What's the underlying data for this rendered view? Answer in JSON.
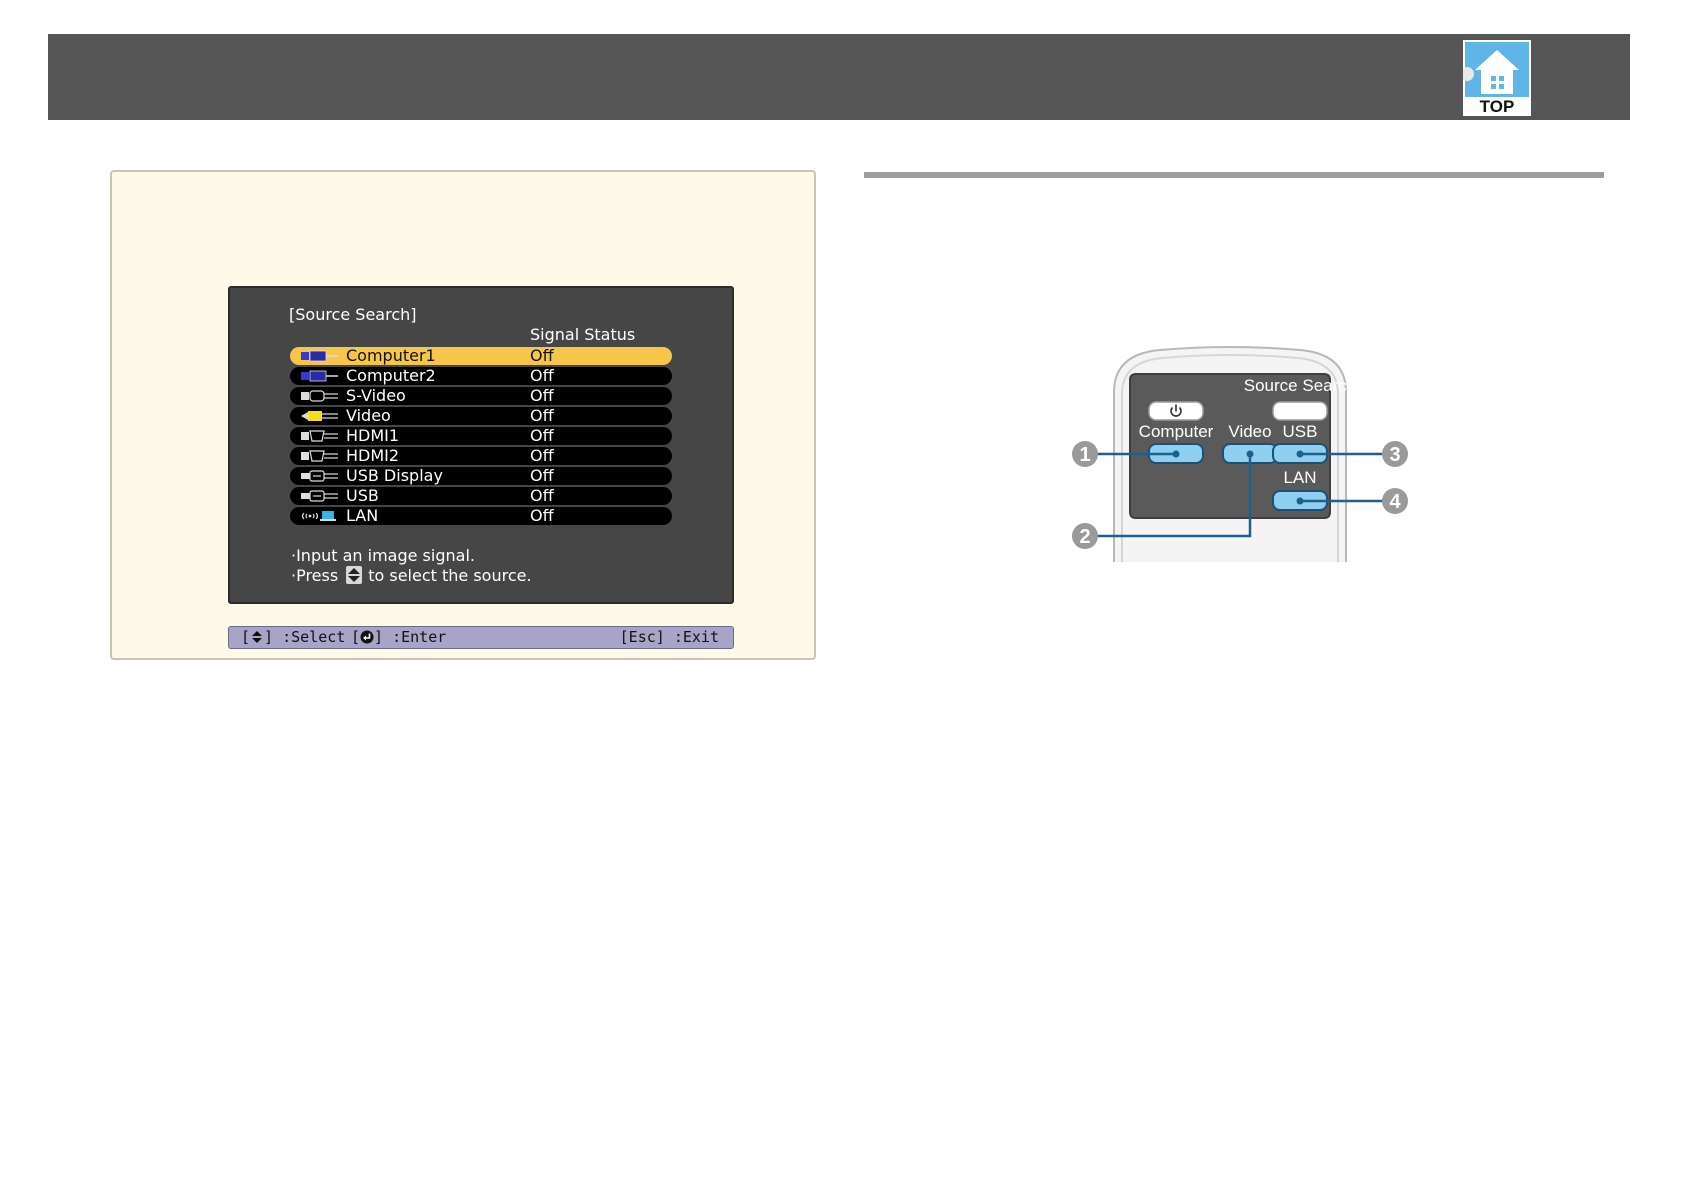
{
  "header": {
    "top_button_label": "TOP"
  },
  "osd": {
    "title": "[Source Search]",
    "column_header": "Signal Status",
    "sources": [
      {
        "label": "Computer1",
        "status": "Off",
        "icon": "computer-port-icon",
        "selected": true
      },
      {
        "label": "Computer2",
        "status": "Off",
        "icon": "computer-port-icon",
        "selected": false
      },
      {
        "label": "S-Video",
        "status": "Off",
        "icon": "svideo-port-icon",
        "selected": false
      },
      {
        "label": "Video",
        "status": "Off",
        "icon": "video-port-icon",
        "selected": false
      },
      {
        "label": "HDMI1",
        "status": "Off",
        "icon": "hdmi-port-icon",
        "selected": false
      },
      {
        "label": "HDMI2",
        "status": "Off",
        "icon": "hdmi-port-icon",
        "selected": false
      },
      {
        "label": "USB Display",
        "status": "Off",
        "icon": "usb-port-icon",
        "selected": false
      },
      {
        "label": "USB",
        "status": "Off",
        "icon": "usb-port-icon",
        "selected": false
      },
      {
        "label": "LAN",
        "status": "Off",
        "icon": "wireless-lan-icon",
        "selected": false
      }
    ],
    "message_line1": "·Input an image signal.",
    "message_line2_prefix": "·Press",
    "message_line2_suffix": "to select the source.",
    "footer": {
      "select_prefix": "[",
      "select_suffix": "] :Select",
      "enter_prefix": "[",
      "enter_suffix": "] :Enter",
      "exit": "[Esc] :Exit"
    },
    "colors": {
      "selected_row": "#f6c64a",
      "row": "#000000",
      "panel": "#464646",
      "footer": "#a8a4c8"
    }
  },
  "remote": {
    "source_search": "Source Search",
    "computer": "Computer",
    "video": "Video",
    "usb": "USB",
    "lan": "LAN",
    "callouts": [
      "1",
      "2",
      "3",
      "4"
    ]
  }
}
